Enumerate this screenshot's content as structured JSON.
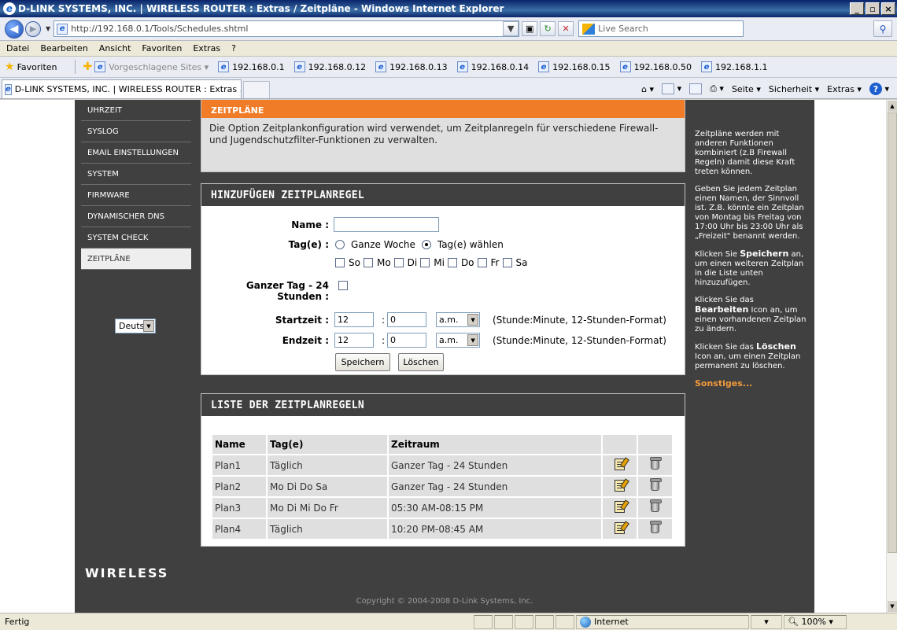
{
  "window": {
    "title": "D-LINK SYSTEMS, INC. | WIRELESS ROUTER : Extras / Zeitpläne - Windows Internet Explorer"
  },
  "address": {
    "url": "http://192.168.0.1/Tools/Schedules.shtml",
    "search_placeholder": "Live Search"
  },
  "menu": [
    "Datei",
    "Bearbeiten",
    "Ansicht",
    "Favoriten",
    "Extras",
    "?"
  ],
  "favorites": {
    "label": "Favoriten",
    "suggested": "Vorgeschlagene Sites",
    "links": [
      "192.168.0.1",
      "192.168.0.12",
      "192.168.0.13",
      "192.168.0.14",
      "192.168.0.15",
      "192.168.0.50",
      "192.168.1.1"
    ]
  },
  "tab": {
    "title": "D-LINK SYSTEMS, INC. | WIRELESS ROUTER : Extras ...",
    "tools": [
      "Seite",
      "Sicherheit",
      "Extras"
    ]
  },
  "leftnav": {
    "items": [
      "UHRZEIT",
      "SYSLOG",
      "EMAIL EINSTELLUNGEN",
      "SYSTEM",
      "FIRMWARE",
      "DYNAMISCHER DNS",
      "SYSTEM CHECK",
      "ZEITPLÄNE"
    ],
    "active_index": 7,
    "language": "Deutsch"
  },
  "intro": {
    "heading": "ZEITPLÄNE",
    "text": "Die Option Zeitplankonfiguration wird verwendet, um Zeitplanregeln für verschiedene Firewall- und Jugendschutzfilter-Funktionen zu verwalten."
  },
  "add_rule": {
    "heading": "HINZUFÜGEN ZEITPLANREGEL",
    "name_label": "Name :",
    "name_value": "",
    "days_label": "Tag(e) :",
    "opt_whole_week": "Ganze Woche",
    "opt_select_days": "Tag(e) wählen",
    "selected_option": "select_days",
    "days": [
      "So",
      "Mo",
      "Di",
      "Mi",
      "Do",
      "Fr",
      "Sa"
    ],
    "allday_label": "Ganzer Tag - 24 Stunden :",
    "allday_line1": "Ganzer Tag - 24",
    "allday_line2": "Stunden :",
    "start_label": "Startzeit :",
    "start_hour": "12",
    "start_min": "0",
    "start_ampm": "a.m.",
    "end_label": "Endzeit :",
    "end_hour": "12",
    "end_min": "0",
    "end_ampm": "a.m.",
    "colon": ":",
    "format_hint": "(Stunde:Minute, 12-Stunden-Format)",
    "save_label": "Speichern",
    "clear_label": "Löschen"
  },
  "rule_list": {
    "heading": "LISTE DER ZEITPLANREGELN",
    "columns": [
      "Name",
      "Tag(e)",
      "Zeitraum"
    ],
    "rows": [
      {
        "name": "Plan1",
        "days": "Täglich",
        "range": "Ganzer Tag - 24 Stunden"
      },
      {
        "name": "Plan2",
        "days": "Mo Di Do Sa",
        "range": "Ganzer Tag - 24 Stunden"
      },
      {
        "name": "Plan3",
        "days": "Mo Di Mi Do Fr",
        "range": "05:30 AM-08:15 PM"
      },
      {
        "name": "Plan4",
        "days": "Täglich",
        "range": "10:20 PM-08:45 AM"
      }
    ]
  },
  "help": {
    "p1": "Zeitpläne werden mit anderen Funktionen kombiniert (z.B Firewall Regeln) damit diese Kraft treten können.",
    "p2": "Geben Sie jedem Zeitplan einen Namen, der Sinnvoll ist. Z.B. könnte ein Zeitplan von Montag bis Freitag von 17:00 Uhr bis 23:00 Uhr als „Freizeit\" benannt werden.",
    "p3_pre": "Klicken Sie ",
    "p3_bold": "Speichern",
    "p3_post": " an, um einen weiteren Zeitplan in die Liste unten hinzuzufügen.",
    "p4_pre": "Klicken Sie das ",
    "p4_bold": "Bearbeiten",
    "p4_post": " Icon an, um einen vorhandenen Zeitplan zu ändern.",
    "p5_pre": "Klicken Sie das ",
    "p5_bold": "Löschen",
    "p5_post": " Icon an, um einen Zeitplan permanent zu löschen.",
    "more": "Sonstiges..."
  },
  "footer": {
    "brand": "WIRELESS",
    "copyright": "Copyright © 2004-2008 D-Link Systems, Inc."
  },
  "status": {
    "text": "Fertig",
    "zone": "Internet",
    "zoom": "100%"
  }
}
